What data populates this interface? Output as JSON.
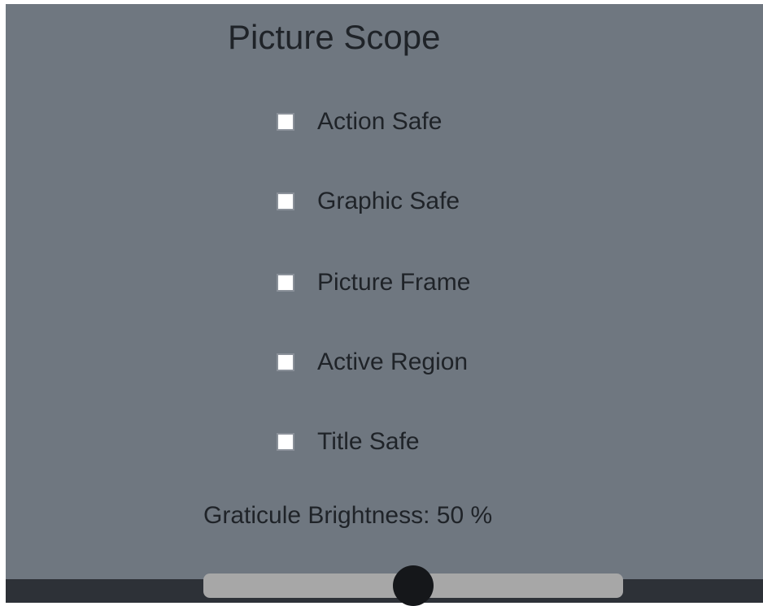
{
  "title": "Picture Scope",
  "options": [
    {
      "label": "Action Safe",
      "checked": false
    },
    {
      "label": "Graphic Safe",
      "checked": false
    },
    {
      "label": "Picture Frame",
      "checked": false
    },
    {
      "label": "Active Region",
      "checked": false
    },
    {
      "label": "Title Safe",
      "checked": false
    }
  ],
  "graticule_brightness": {
    "label": "Graticule Brightness: 50 %",
    "value": 50,
    "min": 0,
    "max": 100
  },
  "colors": {
    "panel_background": "#6f7780",
    "text": "#1f2328",
    "slider_track": "#a7a7a7",
    "slider_thumb": "#15171a",
    "bottom_bar": "#2d3137"
  }
}
